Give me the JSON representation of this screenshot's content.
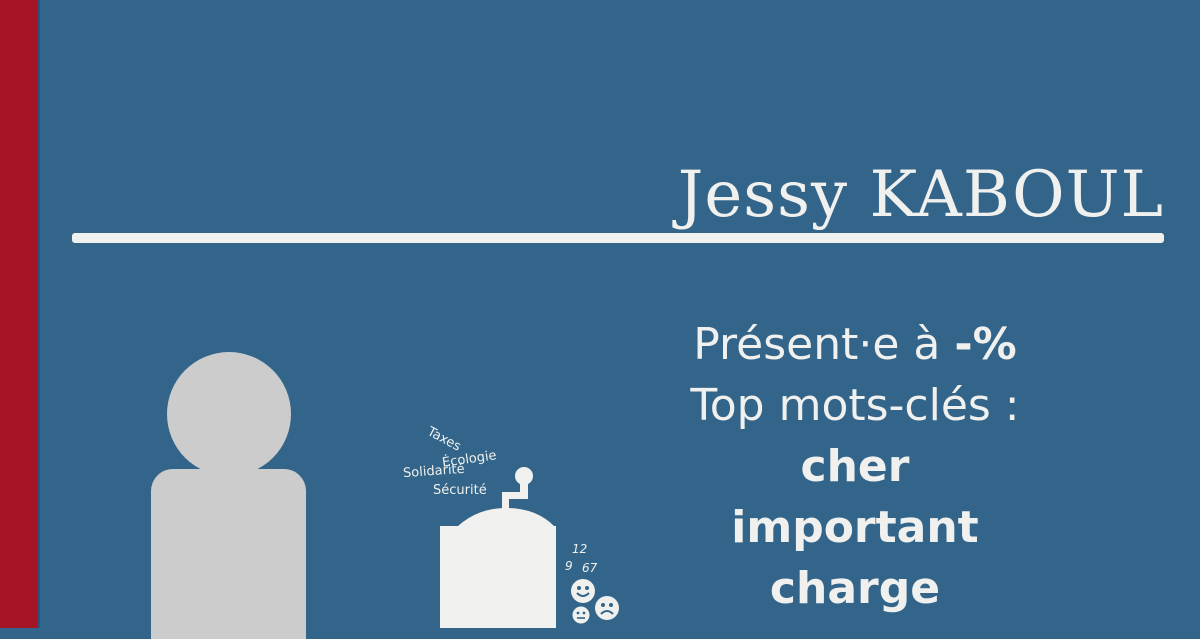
{
  "candidate": {
    "name": "Jessy KABOUL"
  },
  "stats": {
    "presence_prefix": "Présent·e à ",
    "presence_value": "-%",
    "keywords_label": "Top mots-clés :",
    "keywords": [
      "cher",
      "important",
      "charge"
    ]
  },
  "grinder": {
    "words": [
      "Taxes",
      "Écologie",
      "Solidarité",
      "Sécurité"
    ],
    "numbers": [
      "12",
      "9",
      "67"
    ]
  },
  "colors": {
    "background": "#33658a",
    "accent": "#a51423",
    "text": "#f0f0ee",
    "silhouette": "#cccccc"
  }
}
